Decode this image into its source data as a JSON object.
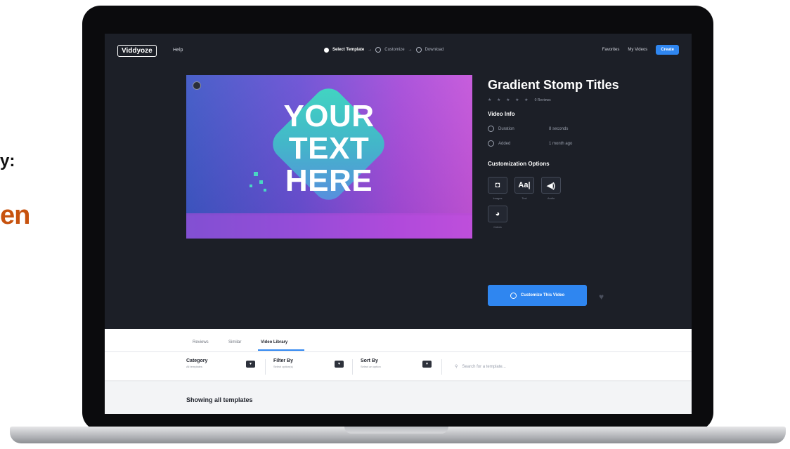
{
  "side": {
    "line1": "y:",
    "line2": "en"
  },
  "nav": {
    "logo": "Viddyoze",
    "help": "Help",
    "steps": [
      "Select Template",
      "Customize",
      "Download"
    ],
    "links": [
      "Favorites",
      "My Videos"
    ],
    "create": "Create"
  },
  "preview": {
    "lines": [
      "YOUR",
      "TEXT",
      "HERE"
    ]
  },
  "video": {
    "title": "Gradient Stomp Titles",
    "stars": "★ ★ ★ ★ ★",
    "reviews": "0 Reviews",
    "info_heading": "Video Info",
    "duration_label": "Duration",
    "duration_value": "8 seconds",
    "added_label": "Added",
    "added_value": "1 month ago",
    "custom_heading": "Customization Options",
    "options": [
      {
        "glyph": "◘",
        "label": "Images",
        "icon": "camera-icon"
      },
      {
        "glyph": "Aa|",
        "label": "Text",
        "icon": "text-icon"
      },
      {
        "glyph": "◀)",
        "label": "Audio",
        "icon": "audio-icon"
      },
      {
        "glyph": "◕",
        "label": "Colors",
        "icon": "palette-icon"
      }
    ],
    "cta": "Customize This Video"
  },
  "tabs": [
    "Reviews",
    "Similar",
    "Video Library"
  ],
  "filters": [
    {
      "label": "Category",
      "sub": "All templates"
    },
    {
      "label": "Filter By",
      "sub": "Select option(s)"
    },
    {
      "label": "Sort By",
      "sub": "Select an option"
    }
  ],
  "search_placeholder": "Search for a template...",
  "showing": "Showing all templates",
  "colors": {
    "accent": "#2f86f0",
    "screen_bg": "#1c1f27",
    "side_orange": "#c7520e"
  }
}
